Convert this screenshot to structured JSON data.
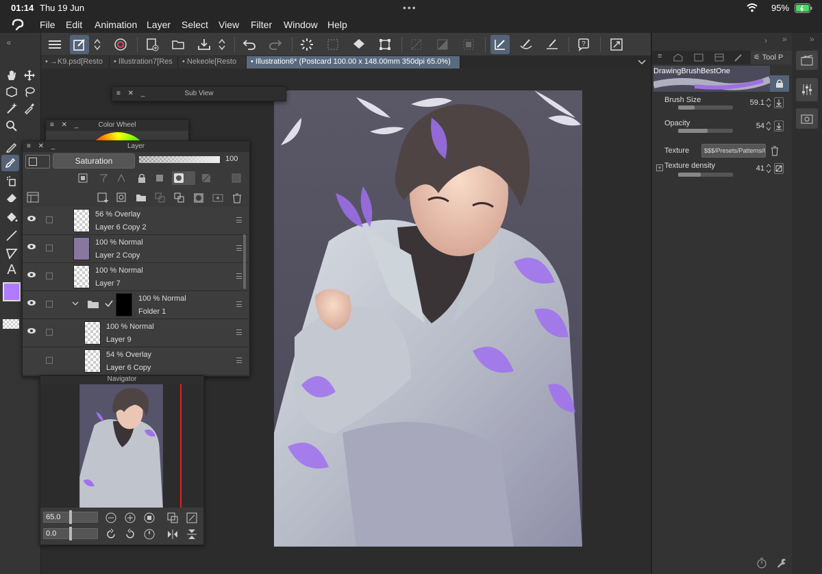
{
  "status": {
    "time": "01:14",
    "date": "Thu 19 Jun",
    "battery": "95%"
  },
  "menu": [
    "File",
    "Edit",
    "Animation",
    "Layer",
    "Select",
    "View",
    "Filter",
    "Window",
    "Help"
  ],
  "tabs": [
    {
      "label": "• →K9.psd[Resto",
      "active": false
    },
    {
      "label": "• Illustration7[Res",
      "active": false
    },
    {
      "label": "• Nekeole[Resto",
      "active": false
    },
    {
      "label": "• Illustration6* (Postcard 100.00 x 148.00mm 350dpi 65.0%)",
      "active": true
    }
  ],
  "subview": {
    "title": "Sub View"
  },
  "colorwheel": {
    "title": "Color Wheel"
  },
  "layer_panel": {
    "title": "Layer",
    "blend_mode": "Saturation",
    "opacity": "100",
    "layers": [
      {
        "line1": "56 % Overlay",
        "line2": "Layer 6 Copy 2",
        "visible": false,
        "indent": 0,
        "folder": false
      },
      {
        "line1": "100 % Normal",
        "line2": "Layer 2 Copy",
        "visible": true,
        "indent": 0,
        "folder": false
      },
      {
        "line1": "100 % Normal",
        "line2": "Layer 7",
        "visible": true,
        "indent": 0,
        "folder": false
      },
      {
        "line1": "100 % Normal",
        "line2": "Folder 1",
        "visible": true,
        "indent": 0,
        "folder": true
      },
      {
        "line1": "100 % Normal",
        "line2": "Layer 9",
        "visible": true,
        "indent": 1,
        "folder": false
      },
      {
        "line1": "54 % Overlay",
        "line2": "Layer 6 Copy",
        "visible": false,
        "indent": 1,
        "folder": false
      }
    ]
  },
  "navigator": {
    "title": "Navigator",
    "zoom": "65.0",
    "rotation": "0.0"
  },
  "tool_property": {
    "tab_label": "Tool P",
    "brush_name": "DrawingBrushBestOne",
    "brush_size_label": "Brush Size",
    "brush_size": "59.1",
    "brush_size_fraction": 0.3,
    "opacity_label": "Opacity",
    "opacity": "54",
    "opacity_fraction": 0.54,
    "texture_label": "Texture",
    "texture_value": "$$$/Presets/Patterns/C",
    "texture_density_label": "Texture density",
    "texture_density": "41",
    "texture_density_fraction": 0.41
  },
  "colors": {
    "accent": "#556378",
    "main_color": "#b07cff",
    "panel_bg": "#3a3a3a"
  }
}
